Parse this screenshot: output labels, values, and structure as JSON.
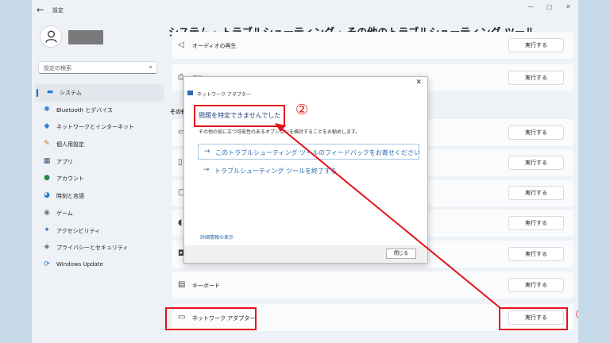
{
  "window": {
    "back": "←",
    "title": "設定",
    "controls": [
      "—",
      "▢",
      "✕"
    ]
  },
  "search": {
    "placeholder": "設定の検索"
  },
  "sidebar": {
    "items": [
      {
        "label": "システム",
        "icon": "monitor-icon",
        "glyph": "▬",
        "color": "#2b7bd3"
      },
      {
        "label": "Bluetooth とデバイス",
        "icon": "bluetooth-icon",
        "glyph": "✱",
        "color": "#2b7bd3"
      },
      {
        "label": "ネットワークとインターネット",
        "icon": "wifi-icon",
        "glyph": "◆",
        "color": "#2b7bd3"
      },
      {
        "label": "個人用設定",
        "icon": "brush-icon",
        "glyph": "✎",
        "color": "#c2761a"
      },
      {
        "label": "アプリ",
        "icon": "apps-icon",
        "glyph": "▦",
        "color": "#3a5577"
      },
      {
        "label": "アカウント",
        "icon": "account-icon",
        "glyph": "●",
        "color": "#1f8a4c"
      },
      {
        "label": "時刻と言語",
        "icon": "globe-clock-icon",
        "glyph": "◕",
        "color": "#2b7bd3"
      },
      {
        "label": "ゲーム",
        "icon": "gamepad-icon",
        "glyph": "◉",
        "color": "#777777"
      },
      {
        "label": "アクセシビリティ",
        "icon": "accessibility-icon",
        "glyph": "✦",
        "color": "#2b6cc4"
      },
      {
        "label": "プライバシーとセキュリティ",
        "icon": "shield-icon",
        "glyph": "◈",
        "color": "#666666"
      },
      {
        "label": "Windows Update",
        "icon": "update-icon",
        "glyph": "⟳",
        "color": "#1a73c8"
      }
    ]
  },
  "breadcrumb": {
    "part1": "システム",
    "part2": "トラブルシューティング",
    "part3": "その他のトラブルシューティング ツール",
    "sep": "›"
  },
  "section_label": "その他",
  "rows": [
    {
      "label": "オーディオの再生",
      "icon": "speaker-icon",
      "glyph": "◁",
      "button": "実行する"
    },
    {
      "label": "印刷",
      "icon": "printer-icon",
      "glyph": "⎙",
      "button": "実行する"
    },
    {
      "label": "",
      "icon": "camera-icon",
      "glyph": "▭",
      "button": "実行する"
    },
    {
      "label": "",
      "icon": "device-icon",
      "glyph": "▯",
      "button": "実行する"
    },
    {
      "label": "",
      "icon": "window-icon",
      "glyph": "▢",
      "button": "実行する"
    },
    {
      "label": "",
      "icon": "mic-icon",
      "glyph": "◖",
      "button": "実行する"
    },
    {
      "label": "",
      "icon": "camera2-icon",
      "glyph": "◘",
      "button": "実行する"
    },
    {
      "label": "キーボード",
      "icon": "keyboard-icon",
      "glyph": "▤",
      "button": "実行する"
    },
    {
      "label": "ネットワーク アダプター",
      "icon": "network-adapter-icon",
      "glyph": "▭",
      "button": "実行する"
    }
  ],
  "dialog": {
    "title": "ネットワーク アダプター",
    "close": "✕",
    "heading": "問題を特定できませんでした",
    "description": "その他の役に立つ可能性のあるオプションを検討することをお勧めします。",
    "option1": "このトラブルシューティング ツールのフィードバックをお寄せください",
    "option2": "トラブルシューティング ツールを終了する",
    "arrow": "→",
    "details_link": "詳細情報の表示",
    "close_button": "閉じる"
  },
  "annotations": {
    "num1": "①",
    "num2": "②",
    "color": "#e4131b"
  }
}
